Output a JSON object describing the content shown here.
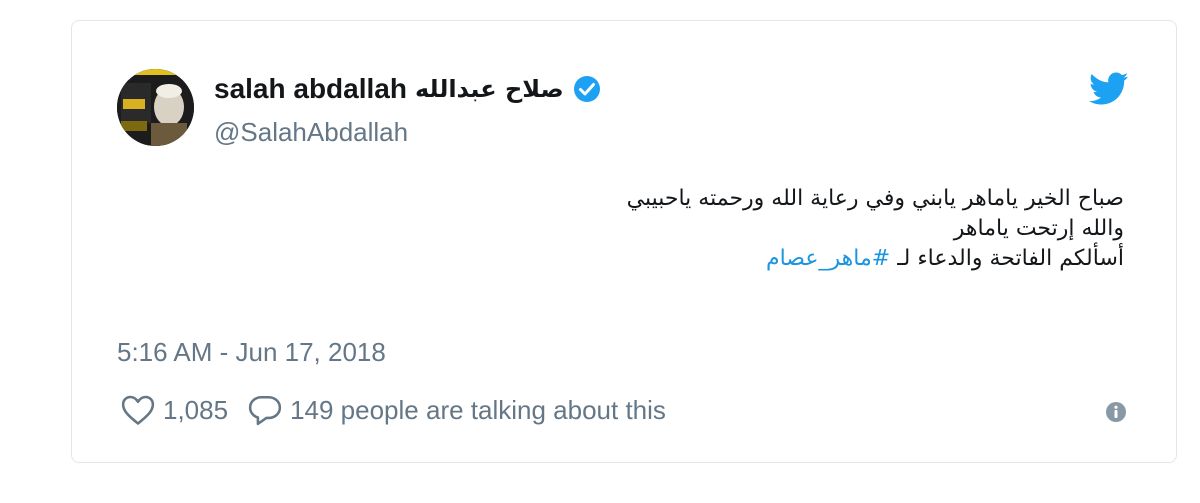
{
  "tweet": {
    "author": {
      "display_name_en": "salah abdallah",
      "display_name_ar": "صلاح عبدالله",
      "handle": "@SalahAbdallah",
      "verified": true
    },
    "text_lines": [
      "صباح الخير ياماهر يابني وفي رعاية الله ورحمته ياحبيبي",
      "والله إرتحت ياماهر"
    ],
    "last_line_prefix": "أسألكم الفاتحة والدعاء لـ",
    "hashtag": "#ماهر_عصام",
    "timestamp": "5:16 AM - Jun 17, 2018",
    "likes_count": "1,085",
    "talking_text": "149 people are talking about this"
  },
  "icons": {
    "brand": "twitter-bird-icon",
    "verified": "verified-badge-icon",
    "like": "heart-icon",
    "reply": "speech-bubble-icon",
    "info": "info-icon"
  },
  "colors": {
    "twitter_blue": "#1da1f2",
    "hashtag": "#1b95e0",
    "text": "#14171a",
    "muted": "#657786",
    "border": "#e1e8ed"
  }
}
